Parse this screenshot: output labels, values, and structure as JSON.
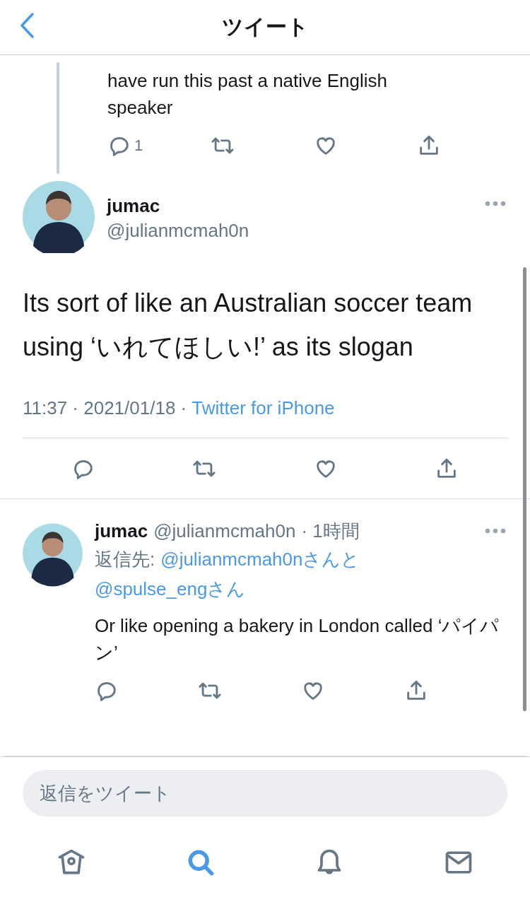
{
  "header": {
    "title": "ツイート"
  },
  "parent_tweet": {
    "text": "have run this past a native English speaker",
    "actions": [
      {
        "kind": "reply",
        "count": "1"
      },
      {
        "kind": "retweet"
      },
      {
        "kind": "like"
      },
      {
        "kind": "share"
      }
    ]
  },
  "main_tweet": {
    "name": "jumac",
    "handle": "@julianmcmah0n",
    "text": "Its sort of like an Australian soccer team using ‘いれてほしい!’ as its slogan",
    "timestamp": "11:37 · 2021/01/18 ·",
    "source": "Twitter for iPhone",
    "actions": [
      {
        "kind": "reply"
      },
      {
        "kind": "retweet"
      },
      {
        "kind": "like"
      },
      {
        "kind": "share"
      }
    ]
  },
  "reply_tweet": {
    "name": "jumac",
    "handle": "@julianmcmah0n",
    "time": "· 1時間",
    "reply_to_label": "返信先:",
    "mentions": [
      "@julianmcmah0nさんと",
      "@spulse_engさん"
    ],
    "text": "Or like opening a bakery in London called ‘パイパン’",
    "actions": [
      {
        "kind": "reply"
      },
      {
        "kind": "retweet"
      },
      {
        "kind": "like"
      },
      {
        "kind": "share"
      }
    ]
  },
  "composer": {
    "placeholder": "返信をツイート"
  },
  "tab_bar": [
    {
      "kind": "home",
      "selected": false
    },
    {
      "kind": "search",
      "selected": true
    },
    {
      "kind": "notifications",
      "selected": false
    },
    {
      "kind": "messages",
      "selected": false
    }
  ]
}
